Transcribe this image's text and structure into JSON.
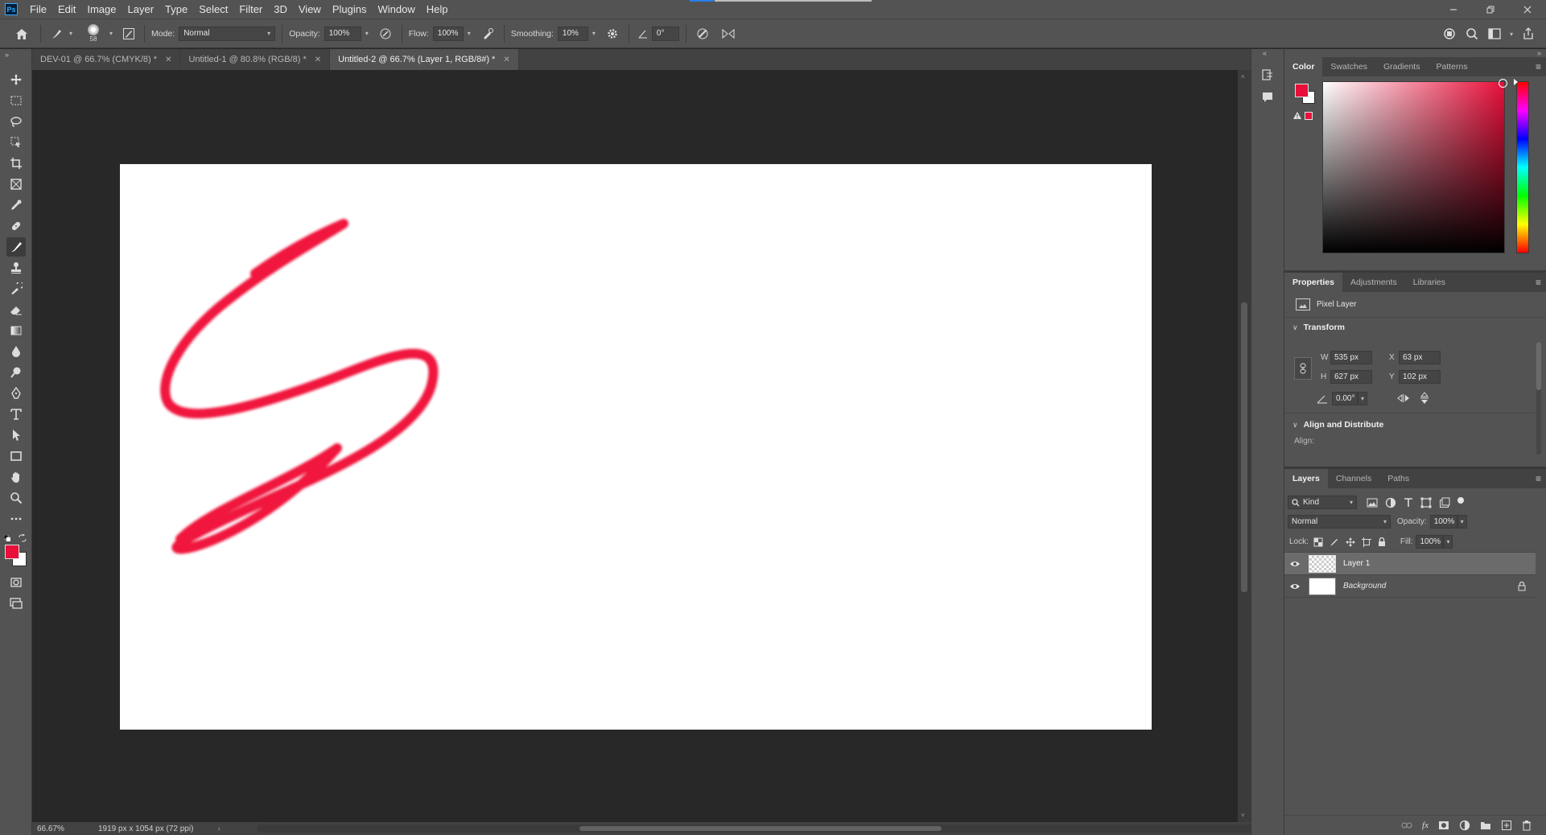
{
  "app": {
    "logo": "Ps"
  },
  "menu": [
    "File",
    "Edit",
    "Image",
    "Layer",
    "Type",
    "Select",
    "Filter",
    "3D",
    "View",
    "Plugins",
    "Window",
    "Help"
  ],
  "window_controls": [
    "minimize-icon",
    "restore-icon",
    "close-icon"
  ],
  "options": {
    "brush_size": "58",
    "mode_label": "Mode:",
    "mode_value": "Normal",
    "opacity_label": "Opacity:",
    "opacity_value": "100%",
    "flow_label": "Flow:",
    "flow_value": "100%",
    "smoothing_label": "Smoothing:",
    "smoothing_value": "10%",
    "angle_value": "0°"
  },
  "tabs": [
    {
      "label": "DEV-01 @ 66.7% (CMYK/8) *",
      "active": false
    },
    {
      "label": "Untitled-1 @ 80.8% (RGB/8) *",
      "active": false
    },
    {
      "label": "Untitled-2 @ 66.7% (Layer 1, RGB/8#) *",
      "active": true
    }
  ],
  "colors": {
    "foreground": "#e8103a",
    "background": "#ffffff",
    "stroke": "#f0143c",
    "ui_dark": "#282828",
    "ui_mid": "#535353"
  },
  "status": {
    "zoom": "66.67%",
    "doc_info": "1919 px x 1054 px (72 ppi)"
  },
  "color_panel": {
    "tabs": [
      "Color",
      "Swatches",
      "Gradients",
      "Patterns"
    ],
    "active_tab": "Color"
  },
  "properties_panel": {
    "tabs": [
      "Properties",
      "Adjustments",
      "Libraries"
    ],
    "layer_type": "Pixel Layer",
    "transform_title": "Transform",
    "w_label": "W",
    "w_value": "535 px",
    "h_label": "H",
    "h_value": "627 px",
    "x_label": "X",
    "x_value": "63 px",
    "y_label": "Y",
    "y_value": "102 px",
    "angle_value": "0.00°",
    "align_title": "Align and Distribute",
    "align_label": "Align:"
  },
  "layers_panel": {
    "tabs": [
      "Layers",
      "Channels",
      "Paths"
    ],
    "filter_kind": "Kind",
    "blend_mode": "Normal",
    "opacity_label": "Opacity:",
    "opacity_value": "100%",
    "lock_label": "Lock:",
    "fill_label": "Fill:",
    "fill_value": "100%",
    "layers": [
      {
        "name": "Layer 1",
        "selected": true,
        "locked": false
      },
      {
        "name": "Background",
        "selected": false,
        "locked": true
      }
    ]
  },
  "tools": [
    "move-tool",
    "marquee-tool",
    "lasso-tool",
    "object-select-tool",
    "crop-tool",
    "frame-tool",
    "eyedropper-tool",
    "healing-tool",
    "brush-tool",
    "stamp-tool",
    "history-brush-tool",
    "eraser-tool",
    "gradient-tool",
    "blur-tool",
    "dodge-tool",
    "pen-tool",
    "type-tool",
    "path-select-tool",
    "rectangle-tool",
    "hand-tool",
    "zoom-tool",
    "more-tools"
  ]
}
